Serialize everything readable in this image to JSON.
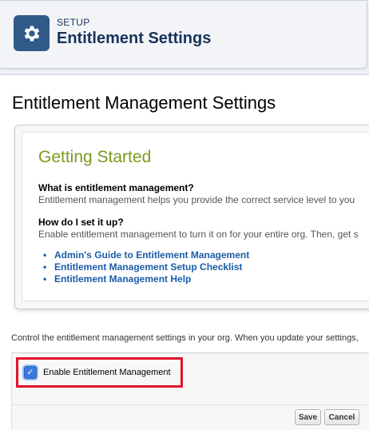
{
  "header": {
    "eyebrow": "SETUP",
    "title": "Entitlement Settings",
    "icon": "gear-icon"
  },
  "page": {
    "title": "Entitlement Management Settings"
  },
  "getting_started": {
    "title": "Getting Started",
    "q1": "What is entitlement management?",
    "a1": "Entitlement management helps you provide the correct service level to you",
    "q2": "How do I set it up?",
    "a2": "Enable entitlement management to turn it on for your entire org. Then, get s",
    "links": [
      "Admin's Guide to Entitlement Management",
      "Entitlement Management Setup Checklist",
      "Entitlement Management Help"
    ]
  },
  "control_text": "Control the entitlement management settings in your org. When you update your settings,",
  "settings": {
    "enable_label": "Enable Entitlement Management",
    "enable_checked": true
  },
  "buttons": {
    "save": "Save",
    "cancel": "Cancel"
  },
  "colors": {
    "highlight": "#e3142b",
    "getting_started_title": "#7a9a1d",
    "link": "#1a5ca8",
    "setup_icon_bg": "#2f5a8a"
  }
}
